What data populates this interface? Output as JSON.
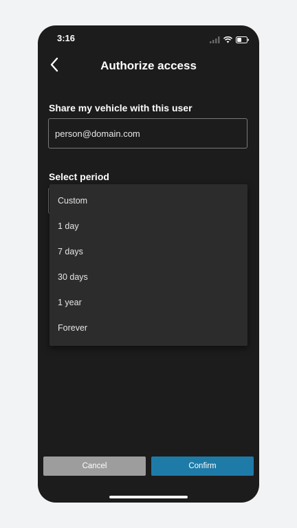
{
  "status_bar": {
    "time": "3:16"
  },
  "header": {
    "title": "Authorize access"
  },
  "share": {
    "label": "Share my vehicle with this user",
    "email_value": "person@domain.com"
  },
  "period": {
    "label": "Select period",
    "options": [
      "Custom",
      "1 day",
      "7 days",
      "30 days",
      "1 year",
      "Forever"
    ]
  },
  "actions": {
    "cancel_label": "Cancel",
    "confirm_label": "Confirm"
  },
  "colors": {
    "background": "#1c1c1c",
    "dropdown": "#2c2c2c",
    "cancel": "#9d9d9d",
    "confirm": "#1e7ba8"
  }
}
